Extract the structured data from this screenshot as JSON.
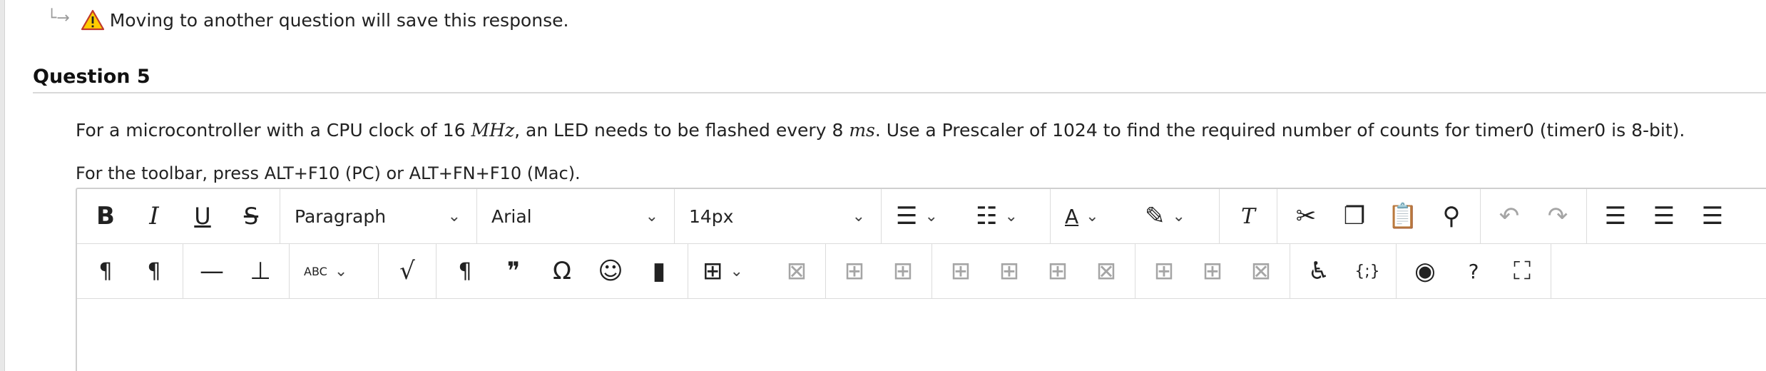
{
  "notice": {
    "text": "Moving to another question will save this response.",
    "icon": "warning-icon",
    "icon_color": "#e8a400"
  },
  "question": {
    "title": "Question 5",
    "prompt_a": "For a microcontroller with a CPU clock of 16 ",
    "prompt_unit1": "MHz",
    "prompt_b": ", an LED needs to be flashed every 8 ",
    "prompt_unit2": "ms",
    "prompt_c": ". Use a Prescaler of 1024 to find the required number of counts for timer0 (timer0 is 8-bit).",
    "toolbar_hint": "For the toolbar, press ALT+F10 (PC) or ALT+FN+F10 (Mac)."
  },
  "editor": {
    "bold": "B",
    "italic": "I",
    "underline": "U",
    "strike": "S",
    "block_format": "Paragraph",
    "font_family": "Arial",
    "font_size": "14px",
    "chevron": "⌄",
    "icons": {
      "bullet": "☰",
      "numbered": "☷",
      "text_color": "A",
      "highlight": "✎",
      "clear": "T",
      "cut": "✂",
      "copy": "❐",
      "paste": "📋",
      "find": "⚲",
      "undo": "↶",
      "redo": "↷",
      "align_left": "☰",
      "align_center": "☰",
      "align_right": "☰",
      "ltr": "¶",
      "rtl": "¶",
      "hr": "—",
      "anchor": "⊥",
      "spell": "ABC",
      "math": "√",
      "pilcrow": "¶",
      "quote": "❞",
      "omega": "Ω",
      "emoji": "☺",
      "bookmark": "▮",
      "table": "⊞",
      "table_del": "⊠",
      "cell1": "⊞",
      "cell2": "⊞",
      "cell3": "⊞",
      "cell4": "⊞",
      "cell5": "⊞",
      "cell6": "⊠",
      "cell7": "⊞",
      "cell8": "⊞",
      "cell9": "⊠",
      "access": "♿",
      "code": "{;}",
      "preview": "◉",
      "help": "?",
      "fullscreen": "⛶"
    }
  }
}
